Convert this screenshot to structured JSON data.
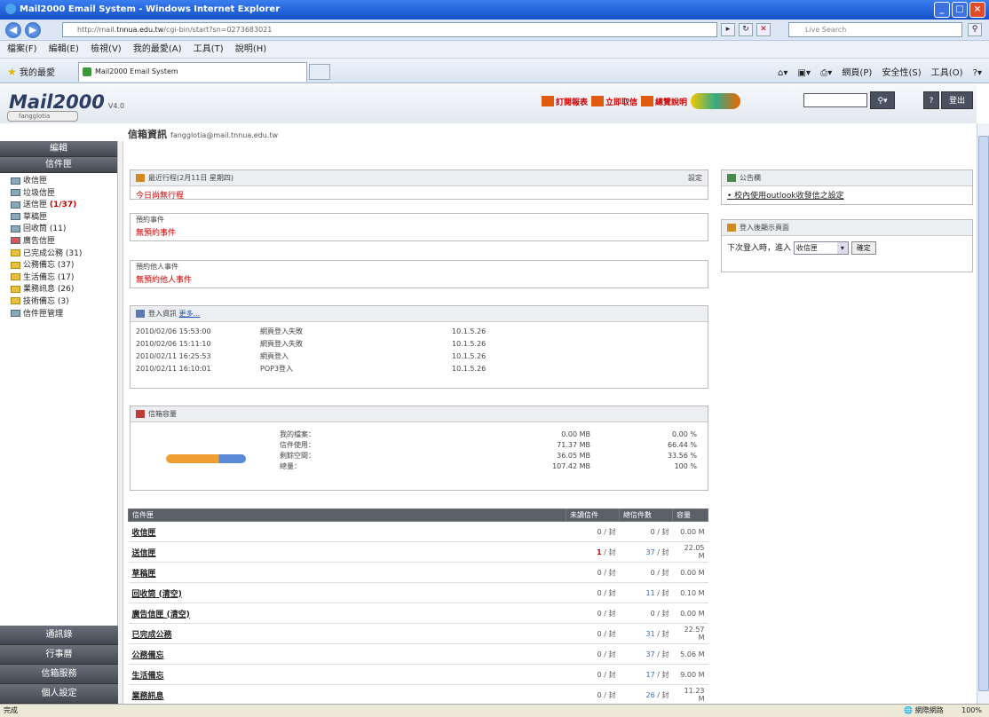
{
  "window": {
    "title": "Mail2000 Email System - Windows Internet Explorer"
  },
  "address": {
    "url_prefix": "http://mail.",
    "url_domain": "tnnua.edu.tw",
    "url_rest": "/cgi-bin/start?sn=0273683021",
    "search_placeholder": "Live Search"
  },
  "menu": [
    "檔案(F)",
    "編輯(E)",
    "檢視(V)",
    "我的最愛(A)",
    "工具(T)",
    "說明(H)"
  ],
  "favorites": {
    "label": "我的最愛",
    "tab_title": "Mail2000 Email System"
  },
  "commands": [
    "網頁(P)",
    "安全性(S)",
    "工具(O)"
  ],
  "app": {
    "logo": "Mail2000",
    "version": "V4.0",
    "user_chip": "fangglotia",
    "header_links": [
      "訂閱報表",
      "立即取信",
      "總覽說明"
    ],
    "breadcrumb_title": "信箱資訊",
    "breadcrumb_user": "fangglotia@mail.tnnua.edu.tw"
  },
  "sidebar": {
    "top_buttons": [
      "編輯",
      "信件匣"
    ],
    "folders": [
      {
        "name": "收信匣",
        "count": ""
      },
      {
        "name": "垃圾信匣",
        "count": ""
      },
      {
        "name": "送信匣",
        "count": "(1/37)"
      },
      {
        "name": "草稿匣",
        "count": ""
      },
      {
        "name": "回收筒",
        "count": "(11)"
      },
      {
        "name": "廣告信匣",
        "count": ""
      },
      {
        "name": "已完成公務",
        "count": "(31)"
      },
      {
        "name": "公務備忘",
        "count": "(37)"
      },
      {
        "name": "生活備忘",
        "count": "(17)"
      },
      {
        "name": "業務訊息",
        "count": "(26)"
      },
      {
        "name": "技術備忘",
        "count": "(3)"
      },
      {
        "name": "信件匣管理",
        "count": ""
      }
    ],
    "bottom_buttons": [
      "通訊錄",
      "行事曆",
      "信箱服務",
      "個人設定"
    ]
  },
  "schedule": {
    "title": "最近行程(2月11日 星期四)",
    "settings": "設定",
    "today_label": "今日尚無行程",
    "reminder_title": "預約事件",
    "reminder_text": "無預約事件",
    "others_title": "預約他人事件",
    "others_text": "無預約他人事件"
  },
  "login_info": {
    "title": "登入資訊",
    "more": "更多...",
    "rows": [
      {
        "time": "2010/02/06 15:53:00",
        "action": "網頁登入失敗",
        "ip": "10.1.5.26"
      },
      {
        "time": "2010/02/06 15:11:10",
        "action": "網頁登入失敗",
        "ip": "10.1.5.26"
      },
      {
        "time": "2010/02/11 16:25:53",
        "action": "網頁登入",
        "ip": "10.1.5.26"
      },
      {
        "time": "2010/02/11 16:10:01",
        "action": "POP3登入",
        "ip": "10.1.5.26"
      }
    ]
  },
  "quota": {
    "title": "信箱容量",
    "used_fraction": 0.6644,
    "rows": [
      {
        "label": "我的檔案：",
        "size": "0.00 MB",
        "pct": "0.00 %"
      },
      {
        "label": "信件使用：",
        "size": "71.37 MB",
        "pct": "66.44 %"
      },
      {
        "label": "剩餘空間：",
        "size": "36.05 MB",
        "pct": "33.56 %"
      },
      {
        "label": "總量：",
        "size": "107.42 MB",
        "pct": "100 %"
      }
    ]
  },
  "folder_table": {
    "headers": [
      "信件匣",
      "未讀信件",
      "總信件數",
      "容量"
    ],
    "rows": [
      {
        "name": "收信匣",
        "unread": "0",
        "total": "0",
        "size": "0.00 M"
      },
      {
        "name": "送信匣",
        "unread": "1",
        "total": "37",
        "size": "22.05 M"
      },
      {
        "name": "草稿匣",
        "unread": "0",
        "total": "0",
        "size": "0.00 M"
      },
      {
        "name": "回收筒 (清空)",
        "unread": "0",
        "total": "11",
        "size": "0.10 M"
      },
      {
        "name": "廣告信匣 (清空)",
        "unread": "0",
        "total": "0",
        "size": "0.00 M"
      },
      {
        "name": "已完成公務",
        "unread": "0",
        "total": "31",
        "size": "22.57 M"
      },
      {
        "name": "公務備忘",
        "unread": "0",
        "total": "37",
        "size": "5.06 M"
      },
      {
        "name": "生活備忘",
        "unread": "0",
        "total": "17",
        "size": "9.00 M"
      },
      {
        "name": "業務訊息",
        "unread": "0",
        "total": "26",
        "size": "11.23 M"
      }
    ],
    "unit": "封"
  },
  "announcement": {
    "title": "公告欄",
    "item": "校內使用outlook收發信之設定"
  },
  "startpage": {
    "title": "登入後顯示頁面",
    "label": "下次登入時，進入",
    "selected": "收信匣",
    "ok": "確定"
  },
  "status": {
    "left": "完成",
    "zone": "網際網路",
    "zoom": "100%"
  }
}
